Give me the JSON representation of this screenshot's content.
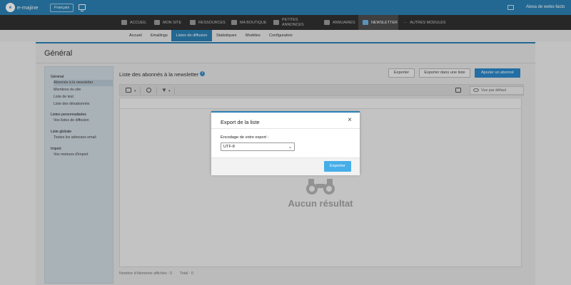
{
  "topbar": {
    "logo_badge": "e",
    "logo_text": "e-majine",
    "language_button": "Français",
    "user_name": "Alexa de webo-facto"
  },
  "main_nav": {
    "items": [
      {
        "label": "Accueil",
        "icon": "home-icon"
      },
      {
        "label": "Mon site",
        "icon": "monitor-icon"
      },
      {
        "label": "Ressources",
        "icon": "resources-icon"
      },
      {
        "label": "Ma boutique",
        "icon": "cart-icon"
      },
      {
        "label_line1": "Petites",
        "label_line2": "annonces",
        "icon": "grid-icon"
      },
      {
        "label": "Annuaires",
        "icon": "directory-icon"
      },
      {
        "label": "Newsletter",
        "icon": "envelope-icon",
        "active": true
      },
      {
        "label": "Autres modules",
        "icon": "ellipsis-icon"
      }
    ]
  },
  "sub_nav": {
    "items": [
      "Accueil",
      "Emailings",
      "Listes de diffusion",
      "Statistiques",
      "Modèles",
      "Configuration"
    ],
    "active": "Listes de diffusion"
  },
  "page": {
    "title": "Général"
  },
  "sidebar": {
    "groups": [
      {
        "heading": "Général",
        "links": [
          "Abonnés à la newsletter",
          "Membres du site",
          "Liste de test",
          "Liste des désabonnés"
        ]
      },
      {
        "heading": "Listes personnalisées",
        "links": [
          "Vos listes de diffusion"
        ]
      },
      {
        "heading": "Liste globale",
        "links": [
          "Toutes les adresses email"
        ]
      },
      {
        "heading": "Import",
        "links": [
          "Vos moteurs d'import"
        ]
      }
    ],
    "active_link": "Abonnés à la newsletter"
  },
  "content": {
    "title": "Liste des abonnés à la newsletter",
    "buttons": {
      "export": "Exporter",
      "export_list": "Exporter dans une liste",
      "add_subscriber": "Ajouter un abonné"
    },
    "view_select": "Vue par défaut",
    "empty_message": "Aucun résultat",
    "footer_shown_label": "Nombre d'éléments affichés : 0",
    "footer_total_label": "Total : 0"
  },
  "modal": {
    "title": "Export de la liste",
    "encoding_label": "Encodage de votre export :",
    "encoding_value": "UTF-8",
    "submit_label": "Exporter"
  },
  "colors": {
    "brand_blue": "#2b7fb3",
    "nav_dark": "#303030",
    "primary_button": "#2b87c8",
    "modal_button": "#46aee8"
  }
}
